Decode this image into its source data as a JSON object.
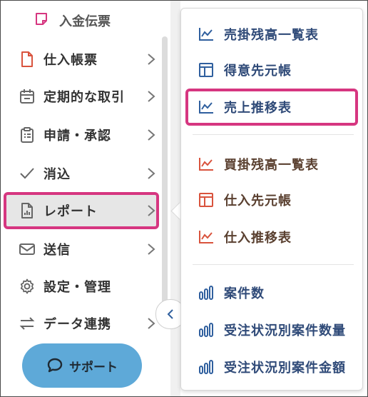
{
  "sidebar": {
    "sub_item": {
      "label": "入金伝票",
      "icon": "note-icon"
    },
    "items": [
      {
        "label": "仕入帳票",
        "icon": "file-icon"
      },
      {
        "label": "定期的な取引",
        "icon": "calendar-icon"
      },
      {
        "label": "申請・承認",
        "icon": "clipboard-icon"
      },
      {
        "label": "消込",
        "icon": "check-icon"
      },
      {
        "label": "レポート",
        "icon": "report-icon"
      },
      {
        "label": "送信",
        "icon": "mail-icon"
      },
      {
        "label": "設定・管理",
        "icon": "gear-icon"
      },
      {
        "label": "データ連携",
        "icon": "swap-icon"
      }
    ],
    "support_label": "サポート"
  },
  "popover": {
    "sales_group": [
      {
        "label": "売掛残高一覧表",
        "icon": "line-chart-icon"
      },
      {
        "label": "得意先元帳",
        "icon": "ledger-icon"
      },
      {
        "label": "売上推移表",
        "icon": "line-chart-icon"
      }
    ],
    "purchase_group": [
      {
        "label": "買掛残高一覧表",
        "icon": "line-chart-icon"
      },
      {
        "label": "仕入先元帳",
        "icon": "ledger-icon"
      },
      {
        "label": "仕入推移表",
        "icon": "line-chart-icon"
      }
    ],
    "project_group": [
      {
        "label": "案件数",
        "icon": "bar-chart-icon"
      },
      {
        "label": "受注状況別案件数量",
        "icon": "bar-chart-icon"
      },
      {
        "label": "受注状況別案件金額",
        "icon": "bar-chart-icon"
      }
    ]
  },
  "colors": {
    "accent_highlight": "#d63680",
    "blue_icon": "#2f5f9e",
    "red_icon": "#d9533d",
    "support_bg": "#5ea9d8"
  }
}
